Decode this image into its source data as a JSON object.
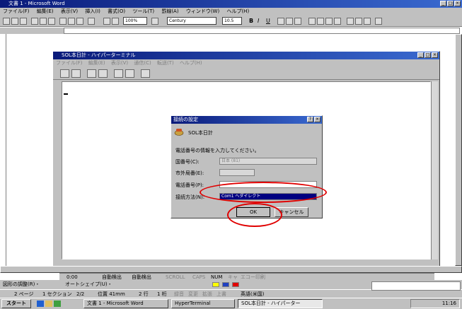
{
  "word": {
    "title": "文書 1 - Microsoft Word",
    "menu": [
      "ファイル(F)",
      "編集(E)",
      "表示(V)",
      "挿入(I)",
      "書式(O)",
      "ツール(T)",
      "罫線(A)",
      "ウィンドウ(W)",
      "ヘルプ(H)"
    ],
    "zoom": "100%",
    "font": "Century",
    "font_size": "10.5"
  },
  "hyper": {
    "title": "SOL本日計 - ハイパーターミナル",
    "menu": [
      "ファイル(F)",
      "編集(E)",
      "表示(V)",
      "通信(C)",
      "転送(T)",
      "ヘルプ(H)"
    ]
  },
  "dialog": {
    "title": "接続の設定",
    "connection_name": "SOL本日計",
    "prompt": "電話番号の情報を入力してください。",
    "country_label": "国番号(C):",
    "country_value": "日本 (81)",
    "area_label": "市外局番(E):",
    "phone_label": "電話番号(P):",
    "method_label": "接続方法(N):",
    "method_value": "Com1 へダイレクト",
    "ok_label": "OK",
    "cancel_label": "キャンセル"
  },
  "hyper_status": [
    "0:00",
    "自動検出",
    "自動検出",
    "SCROLL",
    "CAPS",
    "NUM",
    "キャ",
    "エコー印刷"
  ],
  "word_status": {
    "page": "2 ページ",
    "section": "1 セクション",
    "pages": "2/2",
    "position": "位置 41mm",
    "line": "2 行",
    "col": "1 桁",
    "modes": [
      "録音",
      "変更",
      "拡張",
      "上書"
    ],
    "lang": "英語(米国)"
  },
  "drawing_bar": "図形の調整(R)・",
  "autoshapes": "オートシェイプ(U)・",
  "taskbar": {
    "start": "スタート",
    "tasks": [
      "文書 1 - Microsoft Word",
      "HyperTerminal",
      "SOL本日計 - ハイパーター"
    ],
    "clock": "11:16"
  }
}
